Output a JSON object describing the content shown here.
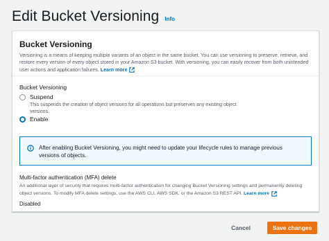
{
  "page": {
    "title": "Edit Bucket Versioning",
    "info_link": "Info"
  },
  "panel": {
    "title": "Bucket Versioning",
    "description": "Versioning is a means of keeping multiple variants of an object in the same bucket. You can use versioning to preserve, retrieve, and restore every version of every object stored in your Amazon S3 bucket. With versioning, you can easily recover from both unintended user actions and application failures.",
    "learn_more": "Learn more"
  },
  "versioning": {
    "label": "Bucket Versioning",
    "options": [
      {
        "label": "Suspend",
        "description": "This suspends the creation of object versions for all operations but preserves any existing object versions.",
        "selected": false
      },
      {
        "label": "Enable",
        "description": "",
        "selected": true
      }
    ]
  },
  "alert": {
    "icon": "info-icon",
    "text": "After enabling Bucket Versioning, you might need to update your lifecycle rules to manage previous versions of objects."
  },
  "mfa": {
    "title": "Multi-factor authentication (MFA) delete",
    "description": "An additional layer of security that requires multi-factor authentication for changing Bucket Versioning settings and permanently deleting object versions. To modify MFA delete settings, use the AWS CLI, AWS SDK, or the Amazon S3 REST API.",
    "learn_more": "Learn more",
    "value": "Disabled"
  },
  "actions": {
    "cancel": "Cancel",
    "save": "Save changes"
  },
  "colors": {
    "primary": "#ec7211",
    "link": "#0073bb",
    "alert_bg": "#f1faff"
  }
}
